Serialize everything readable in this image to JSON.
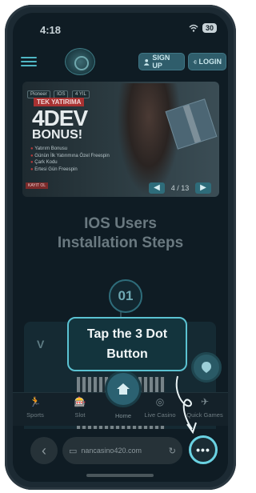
{
  "status_bar": {
    "time": "4:18",
    "battery": "30"
  },
  "header": {
    "signup_label": "SIGN UP",
    "login_label": "LOGIN"
  },
  "banner": {
    "tags": [
      "Pioneer",
      "IOS",
      "4 YIL"
    ],
    "headline_top": "TEK YATIRIMA",
    "headline_main": "4DEV",
    "headline_sub": "BONUS!",
    "list": [
      "Yatırım Bonusu",
      "Günün İlk Yatırımına Özel Freespin",
      "Çark Kodu",
      "Ertesi Gün Freespin"
    ],
    "cta": "KAYIT OL",
    "pager": "4 / 13"
  },
  "page_title_line1": "IOS Users",
  "page_title_line2": "Installation Steps",
  "step": {
    "number": "01",
    "card_letter": "V"
  },
  "tooltip": {
    "line1": "Tap the 3 Dot",
    "line2": "Button"
  },
  "bottom_nav": {
    "items": [
      {
        "label": "Sports",
        "icon": "running-icon"
      },
      {
        "label": "Slot",
        "icon": "slot-machine-icon"
      },
      {
        "label": "Home",
        "icon": "home-icon"
      },
      {
        "label": "Live Casino",
        "icon": "live-casino-icon"
      },
      {
        "label": "Quick Games",
        "icon": "airplane-icon"
      }
    ]
  },
  "browser": {
    "url": "nancasino420.com",
    "more": "•••"
  },
  "colors": {
    "accent": "#5bc2d2",
    "background": "#0f1c24"
  }
}
